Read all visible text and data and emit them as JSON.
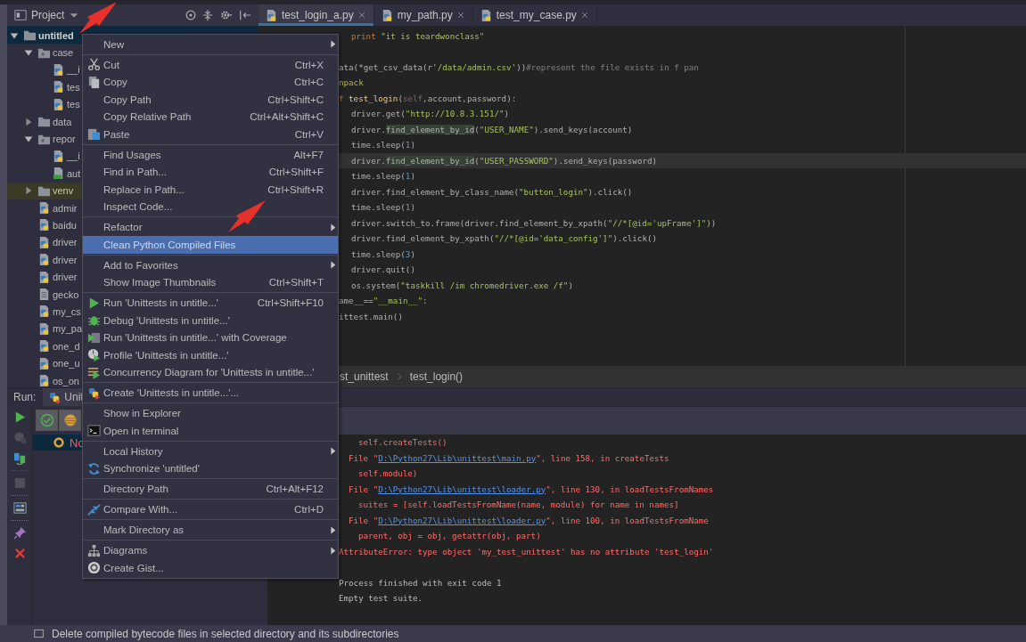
{
  "project_panel": {
    "title": "Project"
  },
  "tree": [
    {
      "label": "untitled",
      "kind": "folder",
      "expanded": true,
      "selected": true,
      "excluded": false,
      "children": [
        {
          "label": "case",
          "kind": "package",
          "expanded": true,
          "selected": false,
          "excluded": false,
          "children": [
            {
              "label": "__i",
              "kind": "python",
              "selected": false,
              "excluded": false
            },
            {
              "label": "tes",
              "kind": "python",
              "selected": false,
              "excluded": false
            },
            {
              "label": "tes",
              "kind": "python",
              "selected": false,
              "excluded": false
            }
          ]
        },
        {
          "label": "data",
          "kind": "folder",
          "expanded": false,
          "selected": false,
          "excluded": false
        },
        {
          "label": "repor",
          "kind": "package",
          "expanded": true,
          "selected": false,
          "excluded": false,
          "children": [
            {
              "label": "__i",
              "kind": "python",
              "selected": false,
              "excluded": false
            },
            {
              "label": "aut",
              "kind": "html",
              "selected": false,
              "excluded": false
            }
          ]
        },
        {
          "label": "venv",
          "kind": "folder",
          "expanded": false,
          "selected": false,
          "excluded": true
        },
        {
          "label": "admir",
          "kind": "python",
          "selected": false,
          "excluded": false
        },
        {
          "label": "baidu",
          "kind": "python",
          "selected": false,
          "excluded": false
        },
        {
          "label": "driver",
          "kind": "python",
          "selected": false,
          "excluded": false
        },
        {
          "label": "driver",
          "kind": "python",
          "selected": false,
          "excluded": false
        },
        {
          "label": "driver",
          "kind": "python",
          "selected": false,
          "excluded": false
        },
        {
          "label": "gecko",
          "kind": "text",
          "selected": false,
          "excluded": false
        },
        {
          "label": "my_cs",
          "kind": "python",
          "selected": false,
          "excluded": false
        },
        {
          "label": "my_pa",
          "kind": "python",
          "selected": false,
          "excluded": false
        },
        {
          "label": "one_d",
          "kind": "python",
          "selected": false,
          "excluded": false
        },
        {
          "label": "one_u",
          "kind": "python",
          "selected": false,
          "excluded": false
        },
        {
          "label": "os_on",
          "kind": "python",
          "selected": false,
          "excluded": false
        }
      ]
    }
  ],
  "tabs": [
    {
      "label": "test_login_a.py",
      "selected": true
    },
    {
      "label": "my_path.py",
      "selected": false
    },
    {
      "label": "test_my_case.py",
      "selected": false
    }
  ],
  "code_lines": [
    {
      "kind": "inner",
      "current": false,
      "segments": [
        {
          "kind": "kw",
          "text": "print "
        },
        {
          "kind": "str",
          "text": "\"it is teardwonclass\""
        }
      ]
    },
    {
      "kind": "blank",
      "current": false
    },
    {
      "kind": "top",
      "current": false,
      "segments": [
        {
          "kind": "plain",
          "text": "ata(*get_csv_data(r"
        },
        {
          "kind": "str",
          "text": "'/data/admin.csv'"
        },
        {
          "kind": "plain",
          "text": "))"
        },
        {
          "kind": "comment",
          "text": "#represent the file exists in f pan"
        }
      ]
    },
    {
      "kind": "top",
      "current": false,
      "segments": [
        {
          "kind": "deco",
          "text": "npack"
        }
      ]
    },
    {
      "kind": "top",
      "current": false,
      "segments": [
        {
          "kind": "kw",
          "text": "f "
        },
        {
          "kind": "fn",
          "text": "test_login"
        },
        {
          "kind": "plain",
          "text": "("
        },
        {
          "kind": "self",
          "text": "self"
        },
        {
          "kind": "plain",
          "text": ",account,password):"
        }
      ]
    },
    {
      "kind": "inner",
      "current": false,
      "segments": [
        {
          "kind": "plain",
          "text": "driver.get("
        },
        {
          "kind": "str",
          "text": "\"http://10.8.3.151/\""
        },
        {
          "kind": "plain",
          "text": ")"
        }
      ]
    },
    {
      "kind": "inner",
      "current": false,
      "segments": [
        {
          "kind": "plain",
          "text": "driver."
        },
        {
          "kind": "usage",
          "text": "find_element_by_id"
        },
        {
          "kind": "plain",
          "text": "("
        },
        {
          "kind": "str",
          "text": "\"USER_NAME\""
        },
        {
          "kind": "plain",
          "text": ").send_keys(account)"
        }
      ]
    },
    {
      "kind": "inner",
      "current": false,
      "segments": [
        {
          "kind": "plain",
          "text": "time.sleep("
        },
        {
          "kind": "num",
          "text": "1"
        },
        {
          "kind": "plain",
          "text": ")"
        }
      ]
    },
    {
      "kind": "inner",
      "current": true,
      "segments": [
        {
          "kind": "plain",
          "text": "driver."
        },
        {
          "kind": "usage",
          "text": "find_element_by_id"
        },
        {
          "kind": "plain",
          "text": "("
        },
        {
          "kind": "str",
          "text": "\"USER_PASSWORD\""
        },
        {
          "kind": "plain",
          "text": ").send_keys(password)"
        }
      ]
    },
    {
      "kind": "inner",
      "current": false,
      "segments": [
        {
          "kind": "plain",
          "text": "time.sleep("
        },
        {
          "kind": "num",
          "text": "1"
        },
        {
          "kind": "plain",
          "text": ")"
        }
      ]
    },
    {
      "kind": "inner",
      "current": false,
      "segments": [
        {
          "kind": "plain",
          "text": "driver.find_element_by_class_name("
        },
        {
          "kind": "str",
          "text": "\"button_login\""
        },
        {
          "kind": "plain",
          "text": ").click()"
        }
      ]
    },
    {
      "kind": "inner",
      "current": false,
      "segments": [
        {
          "kind": "plain",
          "text": "time.sleep("
        },
        {
          "kind": "num",
          "text": "1"
        },
        {
          "kind": "plain",
          "text": ")"
        }
      ]
    },
    {
      "kind": "inner",
      "current": false,
      "segments": [
        {
          "kind": "plain",
          "text": "driver.switch_to.frame(driver.find_element_by_xpath("
        },
        {
          "kind": "str",
          "text": "\"//*[@id='upFrame']\""
        },
        {
          "kind": "plain",
          "text": "))"
        }
      ]
    },
    {
      "kind": "inner",
      "current": false,
      "segments": [
        {
          "kind": "plain",
          "text": "driver.find_element_by_xpath("
        },
        {
          "kind": "str",
          "text": "\"//*[@id='data_config']\""
        },
        {
          "kind": "plain",
          "text": ").click()"
        }
      ]
    },
    {
      "kind": "inner",
      "current": false,
      "segments": [
        {
          "kind": "plain",
          "text": "time.sleep("
        },
        {
          "kind": "num",
          "text": "3"
        },
        {
          "kind": "plain",
          "text": ")"
        }
      ]
    },
    {
      "kind": "inner",
      "current": false,
      "segments": [
        {
          "kind": "plain",
          "text": "driver.quit()"
        }
      ]
    },
    {
      "kind": "inner",
      "current": false,
      "segments": [
        {
          "kind": "plain",
          "text": "os.system("
        },
        {
          "kind": "str",
          "text": "\"taskkill /im chromedriver.exe /f\""
        },
        {
          "kind": "plain",
          "text": ")"
        }
      ]
    },
    {
      "kind": "top",
      "current": false,
      "segments": [
        {
          "kind": "plain",
          "text": "ame__=="
        },
        {
          "kind": "str",
          "text": "\"__main__\""
        },
        {
          "kind": "plain",
          "text": ":"
        }
      ]
    },
    {
      "kind": "top",
      "current": false,
      "segments": [
        {
          "kind": "plain",
          "text": "ittest.main()"
        }
      ]
    }
  ],
  "breadcrumbs": [
    "st_unittest",
    "test_login()"
  ],
  "run_panel": {
    "label": "Run:",
    "tab": "Unit",
    "toolbar": [
      {
        "kind": "run",
        "disabled": false,
        "separator_before": false
      },
      {
        "kind": "rerun_failed",
        "disabled": true,
        "separator_before": false
      },
      {
        "kind": "toggle_auto",
        "disabled": false,
        "separator_before": false
      },
      {
        "kind": "stop",
        "disabled": true,
        "separator_before": true
      },
      {
        "kind": "layout",
        "disabled": false,
        "separator_before": true
      },
      {
        "kind": "pin",
        "disabled": false,
        "separator_before": true
      },
      {
        "kind": "close",
        "disabled": false,
        "separator_before": false
      }
    ],
    "toggles": [
      {
        "kind": "passed",
        "on": true
      },
      {
        "kind": "ignored",
        "on": true
      }
    ],
    "results": [
      {
        "label": "No",
        "selected": true
      }
    ]
  },
  "console_lines": [
    {
      "kind": "code",
      "text": "self.createTests()"
    },
    {
      "kind": "file",
      "segments": [
        {
          "kind": "text",
          "text": "File \""
        },
        {
          "kind": "link",
          "text": "D:\\Python27\\Lib\\unittest\\main.py"
        },
        {
          "kind": "text",
          "text": "\", line 158, in createTests"
        }
      ]
    },
    {
      "kind": "code",
      "text": "self.module)"
    },
    {
      "kind": "file",
      "segments": [
        {
          "kind": "text",
          "text": "File \""
        },
        {
          "kind": "link",
          "text": "D:\\Python27\\Lib\\unittest\\loader.py"
        },
        {
          "kind": "text",
          "text": "\", line 130, in loadTestsFromNames"
        }
      ]
    },
    {
      "kind": "code",
      "text": "suites = [self.loadTestsFromName(name, module) for name in names]"
    },
    {
      "kind": "file",
      "segments": [
        {
          "kind": "text",
          "text": "File \""
        },
        {
          "kind": "link",
          "text": "D:\\Python27\\Lib\\unittest\\loader.py"
        },
        {
          "kind": "text",
          "text": "\", line 100, in loadTestsFromName"
        }
      ]
    },
    {
      "kind": "code",
      "text": "parent, obj = obj, getattr(obj, part)"
    },
    {
      "kind": "error",
      "text": "AttributeError: type object 'my_test_unittest' has no attribute 'test_login'"
    },
    {
      "kind": "blank"
    },
    {
      "kind": "info",
      "text": "Process finished with exit code 1"
    },
    {
      "kind": "info",
      "text": "Empty test suite."
    }
  ],
  "context_menu": {
    "groups": [
      [
        {
          "label": "New",
          "kind": "plain",
          "submenu": true,
          "selected": false
        }
      ],
      [
        {
          "label": "Cut",
          "shortcut": "Ctrl+X",
          "kind": "cut",
          "submenu": false,
          "selected": false
        },
        {
          "label": "Copy",
          "shortcut": "Ctrl+C",
          "kind": "copy",
          "submenu": false,
          "selected": false
        },
        {
          "label": "Copy Path",
          "shortcut": "Ctrl+Shift+C",
          "kind": "plain",
          "submenu": false,
          "selected": false
        },
        {
          "label": "Copy Relative Path",
          "shortcut": "Ctrl+Alt+Shift+C",
          "kind": "plain",
          "submenu": false,
          "selected": false
        },
        {
          "label": "Paste",
          "shortcut": "Ctrl+V",
          "kind": "paste",
          "submenu": false,
          "selected": false
        }
      ],
      [
        {
          "label": "Find Usages",
          "shortcut": "Alt+F7",
          "kind": "plain",
          "submenu": false,
          "selected": false
        },
        {
          "label": "Find in Path...",
          "shortcut": "Ctrl+Shift+F",
          "kind": "plain",
          "submenu": false,
          "selected": false
        },
        {
          "label": "Replace in Path...",
          "shortcut": "Ctrl+Shift+R",
          "kind": "plain",
          "submenu": false,
          "selected": false
        },
        {
          "label": "Inspect Code...",
          "kind": "plain",
          "submenu": false,
          "selected": false
        }
      ],
      [
        {
          "label": "Refactor",
          "kind": "plain",
          "submenu": true,
          "selected": false
        },
        {
          "label": "Clean Python Compiled Files",
          "kind": "plain",
          "submenu": false,
          "selected": true
        }
      ],
      [
        {
          "label": "Add to Favorites",
          "kind": "plain",
          "submenu": true,
          "selected": false
        },
        {
          "label": "Show Image Thumbnails",
          "shortcut": "Ctrl+Shift+T",
          "kind": "plain",
          "submenu": false,
          "selected": false
        }
      ],
      [
        {
          "label": "Run 'Unittests in untitle...'",
          "shortcut": "Ctrl+Shift+F10",
          "kind": "run",
          "submenu": false,
          "selected": false
        },
        {
          "label": "Debug 'Unittests in untitle...'",
          "kind": "debug",
          "submenu": false,
          "selected": false
        },
        {
          "label": "Run 'Unittests in untitle...' with Coverage",
          "kind": "coverage",
          "submenu": false,
          "selected": false
        },
        {
          "label": "Profile 'Unittests in untitle...'",
          "kind": "profile",
          "submenu": false,
          "selected": false
        },
        {
          "label": "Concurrency Diagram for 'Unittests in untitle...'",
          "kind": "concurrency",
          "submenu": false,
          "selected": false
        }
      ],
      [
        {
          "label": "Create 'Unittests in untitle...'...",
          "kind": "create",
          "submenu": false,
          "selected": false
        }
      ],
      [
        {
          "label": "Show in Explorer",
          "kind": "plain",
          "submenu": false,
          "selected": false
        },
        {
          "label": "Open in terminal",
          "kind": "terminal",
          "submenu": false,
          "selected": false
        }
      ],
      [
        {
          "label": "Local History",
          "kind": "plain",
          "submenu": true,
          "selected": false
        },
        {
          "label": "Synchronize 'untitled'",
          "kind": "sync",
          "submenu": false,
          "selected": false
        }
      ],
      [
        {
          "label": "Directory Path",
          "shortcut": "Ctrl+Alt+F12",
          "kind": "plain",
          "submenu": false,
          "selected": false
        }
      ],
      [
        {
          "label": "Compare With...",
          "shortcut": "Ctrl+D",
          "kind": "compare",
          "submenu": false,
          "selected": false
        }
      ],
      [
        {
          "label": "Mark Directory as",
          "kind": "plain",
          "submenu": true,
          "selected": false
        }
      ],
      [
        {
          "label": "Diagrams",
          "kind": "diagrams",
          "submenu": true,
          "selected": false
        },
        {
          "label": "Create Gist...",
          "kind": "gist",
          "submenu": false,
          "selected": false
        }
      ]
    ]
  },
  "status_bar": {
    "text": "Delete compiled bytecode files in selected directory and its subdirectories"
  }
}
